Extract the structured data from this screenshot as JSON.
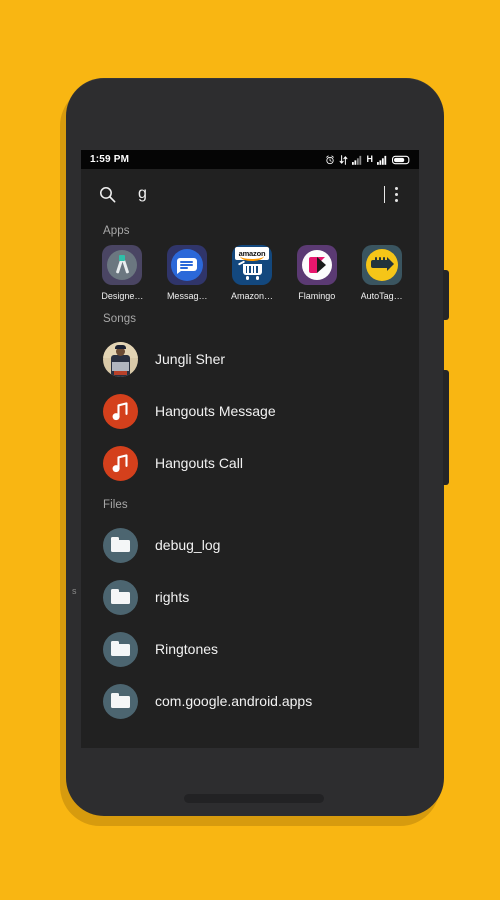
{
  "background": {
    "color": "#F9B612",
    "shadow_color": "#D79B0E"
  },
  "device": {
    "body_color": "#2D2D2F",
    "camera_icon": "camera-dot",
    "earpiece_icon": "earpiece-grille",
    "speaker_icon": "bottom-speaker-grille",
    "buttons": [
      {
        "name": "power-button"
      },
      {
        "name": "volume-rocker"
      }
    ]
  },
  "status_bar": {
    "time": "1:59 PM",
    "icons": [
      "alarm-clock-icon",
      "data-transfer-icon",
      "signal-bars-icon",
      "network-type",
      "signal-bars-2-icon",
      "battery-icon"
    ],
    "network_type": "H"
  },
  "search": {
    "icon": "search-icon",
    "value": "g",
    "placeholder": "Search",
    "overflow_icon": "overflow-menu-icon"
  },
  "sections": {
    "apps": {
      "header": "Apps",
      "items": [
        {
          "label": "Designe…",
          "icon": "designer-app-icon",
          "full_label": "Designer"
        },
        {
          "label": "Messag…",
          "icon": "messages-app-icon",
          "full_label": "Messages"
        },
        {
          "label": "Amazon…",
          "icon": "amazon-app-icon",
          "full_label": "Amazon",
          "wordmark": "amazon"
        },
        {
          "label": "Flamingo",
          "icon": "flamingo-app-icon",
          "full_label": "Flamingo"
        },
        {
          "label": "AutoTag…",
          "icon": "autotag-app-icon",
          "full_label": "AutoTag"
        }
      ]
    },
    "songs": {
      "header": "Songs",
      "items": [
        {
          "label": "Jungli Sher",
          "icon": "album-art"
        },
        {
          "label": "Hangouts Message",
          "icon": "music-note-icon"
        },
        {
          "label": "Hangouts Call",
          "icon": "music-note-icon"
        }
      ]
    },
    "files": {
      "header": "Files",
      "items": [
        {
          "label": "debug_log",
          "icon": "folder-icon"
        },
        {
          "label": "rights",
          "icon": "folder-icon"
        },
        {
          "label": "Ringtones",
          "icon": "folder-icon"
        },
        {
          "label": "com.google.android.apps",
          "icon": "folder-icon"
        }
      ]
    }
  },
  "stray_glyph": "s"
}
